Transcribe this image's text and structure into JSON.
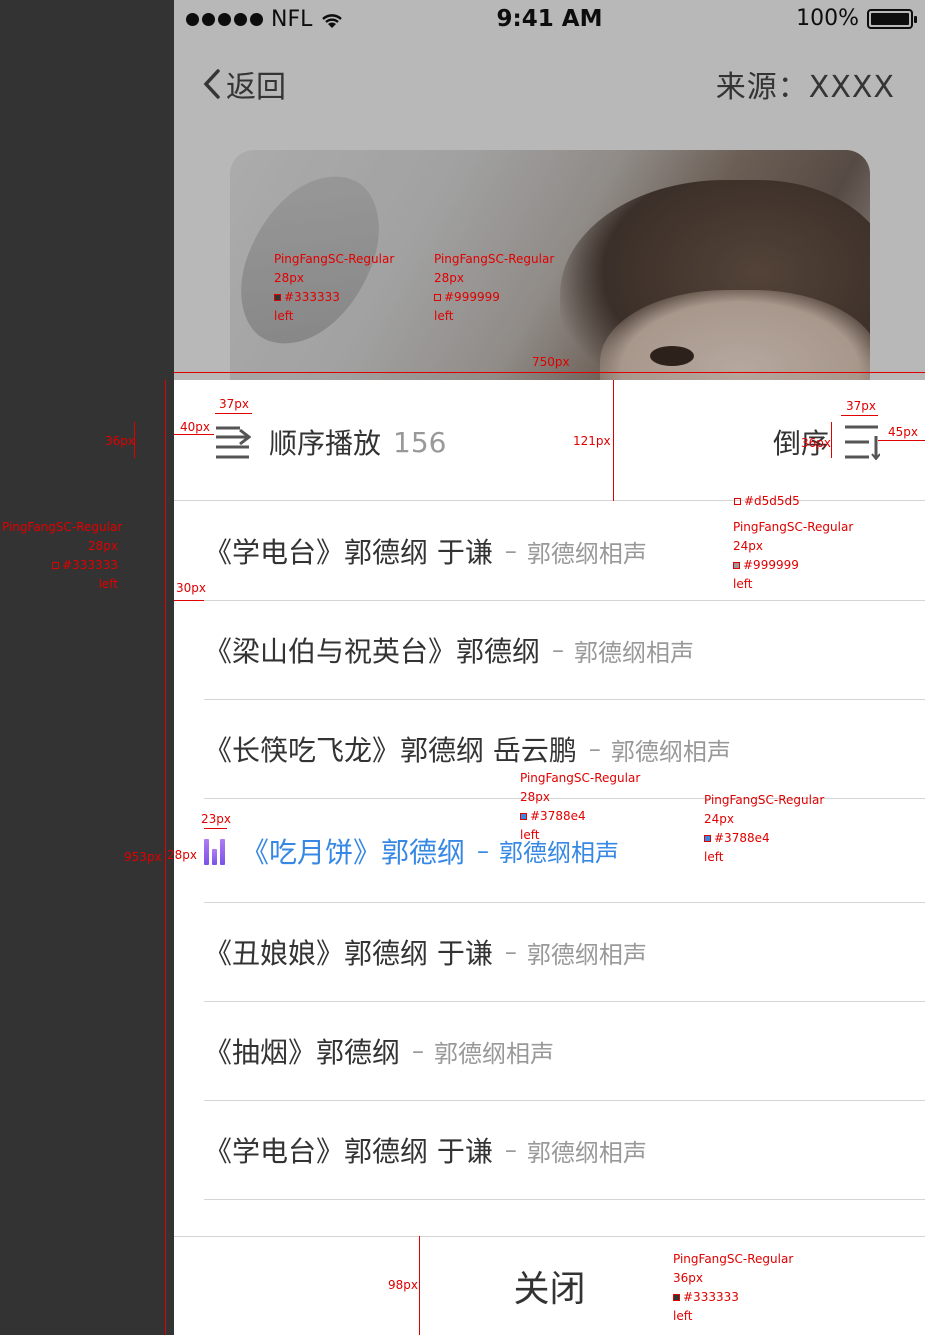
{
  "status_bar": {
    "carrier": "NFL",
    "time": "9:41 AM",
    "battery": "100%"
  },
  "nav": {
    "back_label": "返回",
    "source_label": "来源：XXXX"
  },
  "sheet": {
    "order_label": "顺序播放",
    "order_count": "156",
    "reverse_label": "倒序",
    "close_label": "关闭"
  },
  "list": [
    {
      "title": "《学电台》郭德纲 于谦",
      "sep": "–",
      "artist": "郭德纲相声",
      "active": false
    },
    {
      "title": "《梁山伯与祝英台》郭德纲",
      "sep": "–",
      "artist": "郭德纲相声",
      "active": false
    },
    {
      "title": "《长筷吃飞龙》郭德纲 岳云鹏",
      "sep": "–",
      "artist": "郭德纲相声",
      "active": false
    },
    {
      "title": "《吃月饼》郭德纲",
      "sep": "–",
      "artist": "郭德纲相声",
      "active": true
    },
    {
      "title": "《丑娘娘》郭德纲 于谦",
      "sep": "–",
      "artist": "郭德纲相声",
      "active": false
    },
    {
      "title": "《抽烟》郭德纲",
      "sep": "–",
      "artist": "郭德纲相声",
      "active": false
    },
    {
      "title": "《学电台》郭德纲 于谦",
      "sep": "–",
      "artist": "郭德纲相声",
      "active": false
    }
  ],
  "colors": {
    "text_primary": "#333333",
    "text_secondary": "#999999",
    "accent": "#3788e4",
    "divider": "#d5d5d5"
  },
  "annotations": {
    "font_a": {
      "font": "PingFangSC-Regular",
      "size": "28px",
      "color": "#333333",
      "align": "left"
    },
    "font_b": {
      "font": "PingFangSC-Regular",
      "size": "28px",
      "color": "#999999",
      "align": "left"
    },
    "font_c": {
      "font": "PingFangSC-Regular",
      "size": "28px",
      "color": "#333333",
      "align": "left"
    },
    "font_d": {
      "font": "PingFangSC-Regular",
      "size": "24px",
      "color": "#999999",
      "align": "left"
    },
    "font_e": {
      "font": "PingFangSC-Regular",
      "size": "28px",
      "color": "#3788e4",
      "align": "left"
    },
    "font_f": {
      "font": "PingFangSC-Regular",
      "size": "24px",
      "color": "#3788e4",
      "align": "left"
    },
    "font_g": {
      "font": "PingFangSC-Regular",
      "size": "36px",
      "color": "#333333",
      "align": "left"
    },
    "divider_color": "#d5d5d5",
    "dims": {
      "w750": "750px",
      "w37a": "37px",
      "w37b": "37px",
      "w40": "40px",
      "h36a": "36px",
      "h36b": "36px",
      "w45": "45px",
      "h121": "121px",
      "w30": "30px",
      "w23": "23px",
      "h28": "28px",
      "h953": "953px",
      "h98": "98px"
    }
  }
}
